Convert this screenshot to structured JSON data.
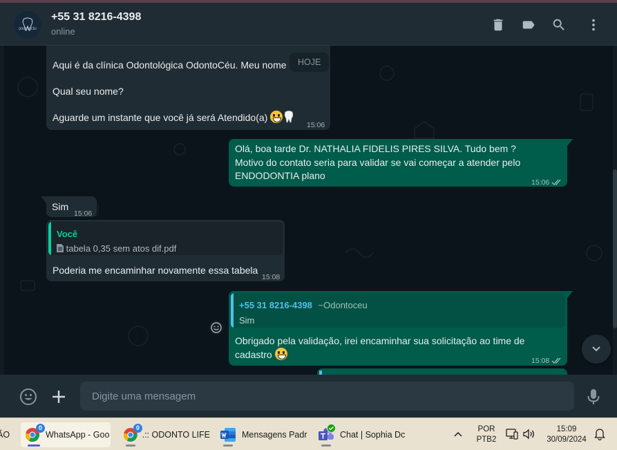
{
  "header": {
    "contact_name": "+55 31 8216-4398",
    "status": "online",
    "avatar_text": "ODONTOCÉU"
  },
  "chat": {
    "date_label": "HOJE",
    "messages": [
      {
        "lines": [
          "Aqui é da clínica  Odontológica OdontoCéu. Meu nome",
          "Qual seu nome?",
          "Aguarde um instante que você já será Atendido(a)"
        ],
        "time": "15:06"
      },
      {
        "lines": [
          "Olá, boa tarde Dr. NATHALIA FIDELIS PIRES SILVA. Tudo bem ?",
          "Motivo do contato seria para validar se vai começar a atender pelo",
          "ENDODONTIA plano"
        ],
        "time": "15:06"
      },
      {
        "text": "Sim",
        "time": "15:06"
      },
      {
        "quote_author": "Você",
        "quote_file": "tabela 0,35 sem atos dif.pdf",
        "text": "Poderia me encaminhar novamente essa tabela",
        "time": "15:08"
      },
      {
        "quote_author": "+55 31 8216-4398",
        "quote_pushname": "~Odontoceu",
        "quote_text": "Sim",
        "lines": [
          "Obrigado pela validação, irei encaminhar sua solicitação ao time de",
          "cadastro"
        ],
        "time": "15:08"
      }
    ]
  },
  "composer": {
    "placeholder": "Digite uma mensagem"
  },
  "taskbar": {
    "edge_partial": "ÃO",
    "apps": [
      {
        "label": "WhatsApp - Goo",
        "badge": "0"
      },
      {
        "label": ".:: ODONTO LIFE",
        "badge": "0"
      },
      {
        "label": "Mensagens Padr"
      },
      {
        "label": "Chat | Sophia Dc"
      }
    ],
    "language": [
      "POR",
      "PTB2"
    ],
    "time": "15:09",
    "date": "30/09/2024"
  },
  "colors": {
    "incoming_bubble": "#202c33",
    "outgoing_bubble": "#005c4b",
    "quote_you": "#06cf9c",
    "quote_contact": "#53bdeb"
  }
}
